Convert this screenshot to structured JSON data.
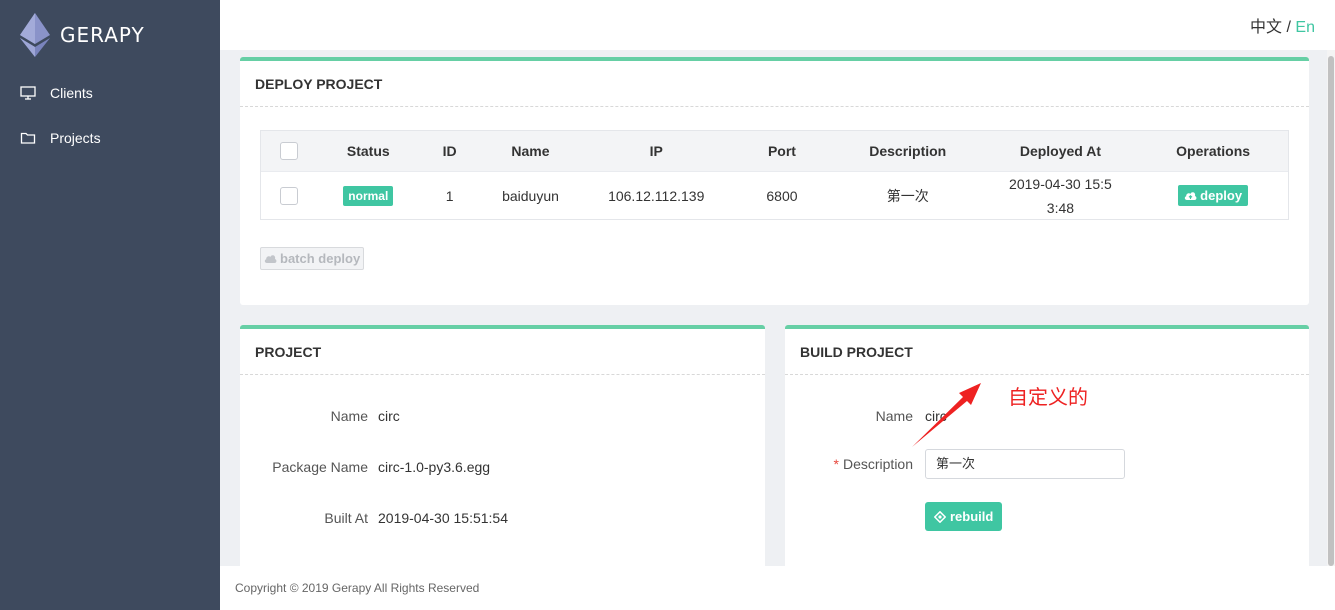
{
  "app": {
    "title": "GERAPY"
  },
  "sidebar": {
    "items": [
      {
        "label": "Clients",
        "icon": "monitor-icon"
      },
      {
        "label": "Projects",
        "icon": "folder-icon"
      }
    ]
  },
  "header": {
    "lang_zh": "中文",
    "lang_sep": "/",
    "lang_en": "En"
  },
  "deploy": {
    "title": "DEPLOY PROJECT",
    "columns": [
      "Status",
      "ID",
      "Name",
      "IP",
      "Port",
      "Description",
      "Deployed At",
      "Operations"
    ],
    "rows": [
      {
        "status": "normal",
        "id": "1",
        "name": "baiduyun",
        "ip": "106.12.112.139",
        "port": "6800",
        "description": "第一次",
        "deployed_at_1": "2019-04-30 15:5",
        "deployed_at_2": "3:48",
        "operation": "deploy"
      }
    ],
    "batch_label": "batch deploy"
  },
  "project": {
    "title": "PROJECT",
    "name_label": "Name",
    "name_value": "circ",
    "package_label": "Package Name",
    "package_value": "circ-1.0-py3.6.egg",
    "built_label": "Built At",
    "built_value": "2019-04-30 15:51:54"
  },
  "build": {
    "title": "BUILD PROJECT",
    "name_label": "Name",
    "name_value": "circ",
    "required_mark": "*",
    "desc_label": "Description",
    "desc_value": "第一次",
    "rebuild_label": "rebuild"
  },
  "annotation": {
    "text": "自定义的",
    "color": "#ee2222"
  },
  "footer": {
    "copyright": "Copyright © 2019 Gerapy All Rights Reserved"
  },
  "colors": {
    "accent": "#3fc6a2",
    "sidebar": "#3e4a5e",
    "card_top": "#66cfa5"
  }
}
